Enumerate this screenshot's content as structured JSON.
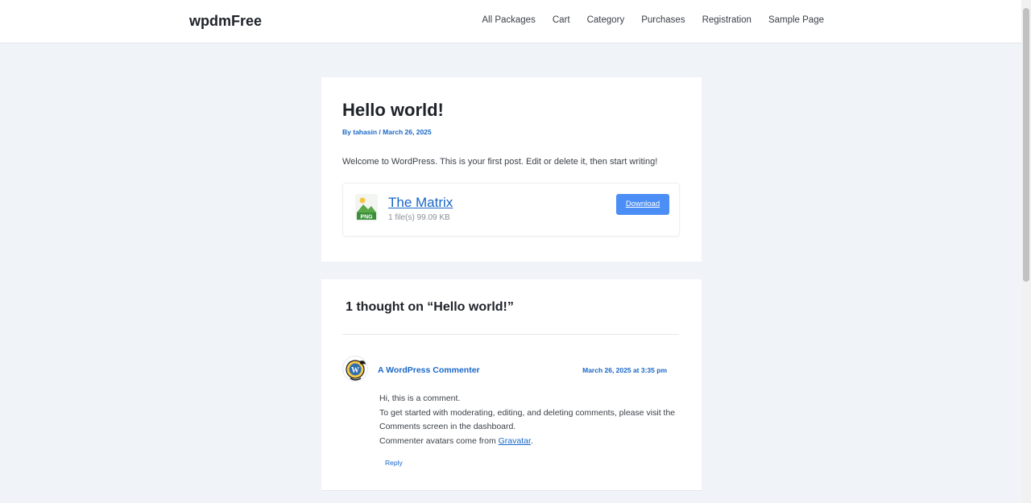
{
  "site": {
    "title": "wpdmFree"
  },
  "nav": [
    "All Packages",
    "Cart",
    "Category",
    "Purchases",
    "Registration",
    "Sample Page"
  ],
  "post": {
    "title": "Hello world!",
    "author_prefix": "By",
    "author": "tahasin",
    "separator": "/",
    "date": "March 26, 2025",
    "body": "Welcome to WordPress. This is your first post. Edit or delete it, then start writing!"
  },
  "package": {
    "icon": "png-file-icon",
    "icon_label": "PNG",
    "name": "The Matrix",
    "info": "1 file(s) 99.09 KB",
    "download_label": "Download",
    "accent": "#4b8ef5"
  },
  "comments": {
    "title": "1 thought on “Hello world!”",
    "items": [
      {
        "author": "A WordPress Commenter",
        "date": "March 26, 2025 at 3:35 pm",
        "line1": "Hi, this is a comment.",
        "line2": "To get started with moderating, editing, and deleting comments, please visit the Comments screen in the dashboard.",
        "line3_prefix": "Commenter avatars come from",
        "line3_link": "Gravatar",
        "line3_suffix": ".",
        "reply_label": "Reply"
      }
    ]
  },
  "colors": {
    "link": "#1967c8",
    "background": "#f0f3f8"
  }
}
